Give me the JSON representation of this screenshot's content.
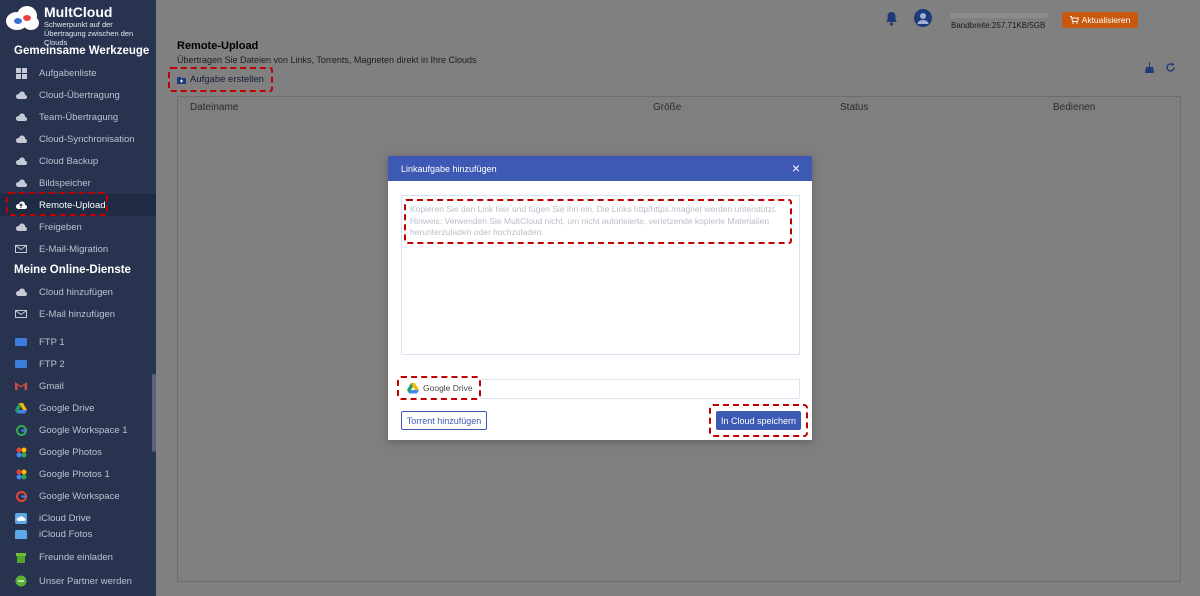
{
  "app": {
    "logo_title": "MultCloud",
    "logo_subtitle": "Schwerpunkt auf der Übertragung zwischen den Clouds"
  },
  "sidebar": {
    "section_tools": "Gemeinsame Werkzeuge",
    "tools": [
      {
        "label": "Aufgabenliste",
        "icon": "grid-icon"
      },
      {
        "label": "Cloud-Übertragung",
        "icon": "cloud-transfer-icon"
      },
      {
        "label": "Team-Übertragung",
        "icon": "team-transfer-icon"
      },
      {
        "label": "Cloud-Synchronisation",
        "icon": "cloud-sync-icon"
      },
      {
        "label": "Cloud Backup",
        "icon": "cloud-backup-icon"
      },
      {
        "label": "Bildspeicher",
        "icon": "image-storage-icon"
      },
      {
        "label": "Remote-Upload",
        "icon": "remote-upload-icon"
      },
      {
        "label": "Freigeben",
        "icon": "share-icon"
      },
      {
        "label": "E-Mail-Migration",
        "icon": "email-migration-icon"
      }
    ],
    "section_services": "Meine Online-Dienste",
    "services": [
      {
        "label": "Cloud hinzufügen",
        "icon": "add-cloud-icon"
      },
      {
        "label": "E-Mail hinzufügen",
        "icon": "add-email-icon"
      },
      {
        "label": "FTP 1",
        "icon": "ftp-icon"
      },
      {
        "label": "FTP 2",
        "icon": "ftp-icon"
      },
      {
        "label": "Gmail",
        "icon": "gmail-icon"
      },
      {
        "label": "Google Drive",
        "icon": "google-drive-icon"
      },
      {
        "label": "Google Workspace 1",
        "icon": "google-workspace-icon"
      },
      {
        "label": "Google Photos",
        "icon": "google-photos-icon"
      },
      {
        "label": "Google Photos 1",
        "icon": "google-photos-icon"
      },
      {
        "label": "Google Workspace",
        "icon": "google-workspace-icon"
      },
      {
        "label": "iCloud Drive",
        "icon": "icloud-drive-icon"
      },
      {
        "label": "iCloud Fotos",
        "icon": "icloud-photos-icon"
      }
    ],
    "bottom": [
      {
        "label": "Freunde einladen",
        "icon": "invite-friends-icon"
      },
      {
        "label": "Unser Partner werden",
        "icon": "partner-icon"
      }
    ]
  },
  "header": {
    "bandwidth": "Bandbreite:257.71KB/5GB",
    "upgrade_label": "Aktualisieren"
  },
  "page": {
    "title": "Remote-Upload",
    "subtitle": "Übertragen Sie Dateien von Links, Torrents, Magneten direkt in Ihre Clouds",
    "create_task": "Aufgabe erstellen",
    "columns": [
      "Dateiname",
      "Größe",
      "Status",
      "Bedienen"
    ]
  },
  "modal": {
    "title": "Linkaufgabe hinzufügen",
    "textarea_placeholder": "Kopieren Sie den Link hier und fügen Sie ihn ein. Die Links http/https /magnet werden unterstützt.\nHinweis: Verwenden Sie MultCloud nicht, um nicht autorisierte, verletzende kopierte Materialien herunterzuladen oder hochzuladen.",
    "destination": "Google Drive",
    "torrent_button": "Torrent hinzufügen",
    "save_button": "In Cloud speichern"
  },
  "colors": {
    "sidebar_bg": "#27334f",
    "accent": "#3e59b3",
    "upgrade": "#c8580e",
    "highlight": "#c00000"
  }
}
